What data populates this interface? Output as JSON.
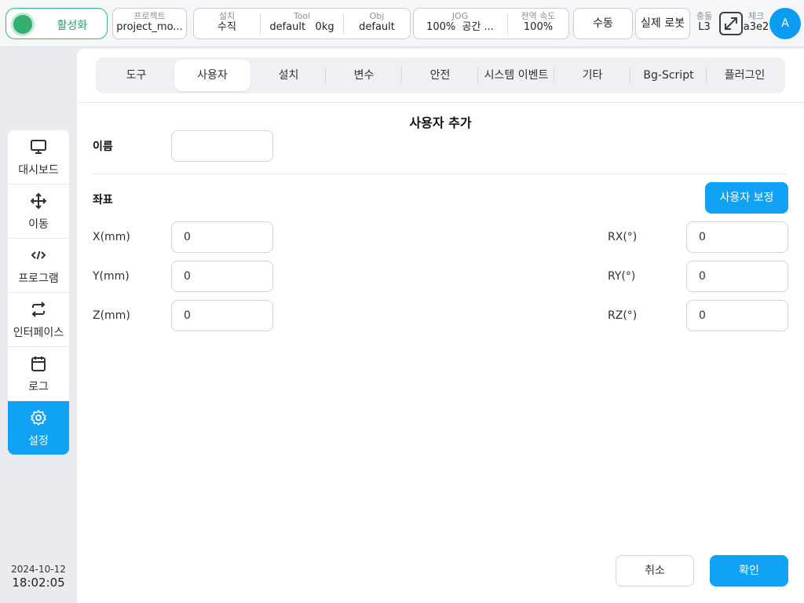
{
  "topbar": {
    "power": {
      "label": "활성화",
      "color": "#33b06f"
    },
    "project": {
      "label": "프로젝트",
      "value": "project_mo..."
    },
    "install": {
      "label": "설치",
      "value": "수직",
      "tool_label": "Tool",
      "tool_value": "default",
      "payload": "0kg",
      "obj_label": "Obj",
      "obj_value": "default"
    },
    "jog": {
      "label": "JOG",
      "speed": "100%",
      "frame": "공간 ...",
      "global_label": "전역 속도",
      "global_value": "100%"
    },
    "mode_button": "수동",
    "robot_button": "실제 로봇",
    "collision": {
      "label": "충돌",
      "value": "L3"
    },
    "check": {
      "label": "체크",
      "value": "a3e2"
    },
    "avatar": "A"
  },
  "sidebar": {
    "items": [
      {
        "label": "대시보드",
        "icon": "monitor-icon"
      },
      {
        "label": "이동",
        "icon": "move-icon"
      },
      {
        "label": "프로그램",
        "icon": "code-icon"
      },
      {
        "label": "인터페이스",
        "icon": "swap-icon"
      },
      {
        "label": "로그",
        "icon": "calendar-icon"
      },
      {
        "label": "설정",
        "icon": "gear-icon",
        "active": true
      }
    ],
    "date": "2024-10-12",
    "time": "18:02:05"
  },
  "tabs": [
    "도구",
    "사용자",
    "설치",
    "변수",
    "안전",
    "시스템 이벤트",
    "기타",
    "Bg-Script",
    "플러그인"
  ],
  "active_tab": "사용자",
  "form": {
    "title": "사용자 추가",
    "name_label": "이름",
    "name_value": "",
    "coords_label": "좌표",
    "calibrate_button": "사용자 보정",
    "x_label": "X(mm)",
    "x_value": "0",
    "y_label": "Y(mm)",
    "y_value": "0",
    "z_label": "Z(mm)",
    "z_value": "0",
    "rx_label": "RX(°)",
    "rx_value": "0",
    "ry_label": "RY(°)",
    "ry_value": "0",
    "rz_label": "RZ(°)",
    "rz_value": "0",
    "cancel_button": "취소",
    "confirm_button": "확인"
  },
  "colors": {
    "accent": "#10a2f5",
    "active_green": "#33b06f"
  }
}
